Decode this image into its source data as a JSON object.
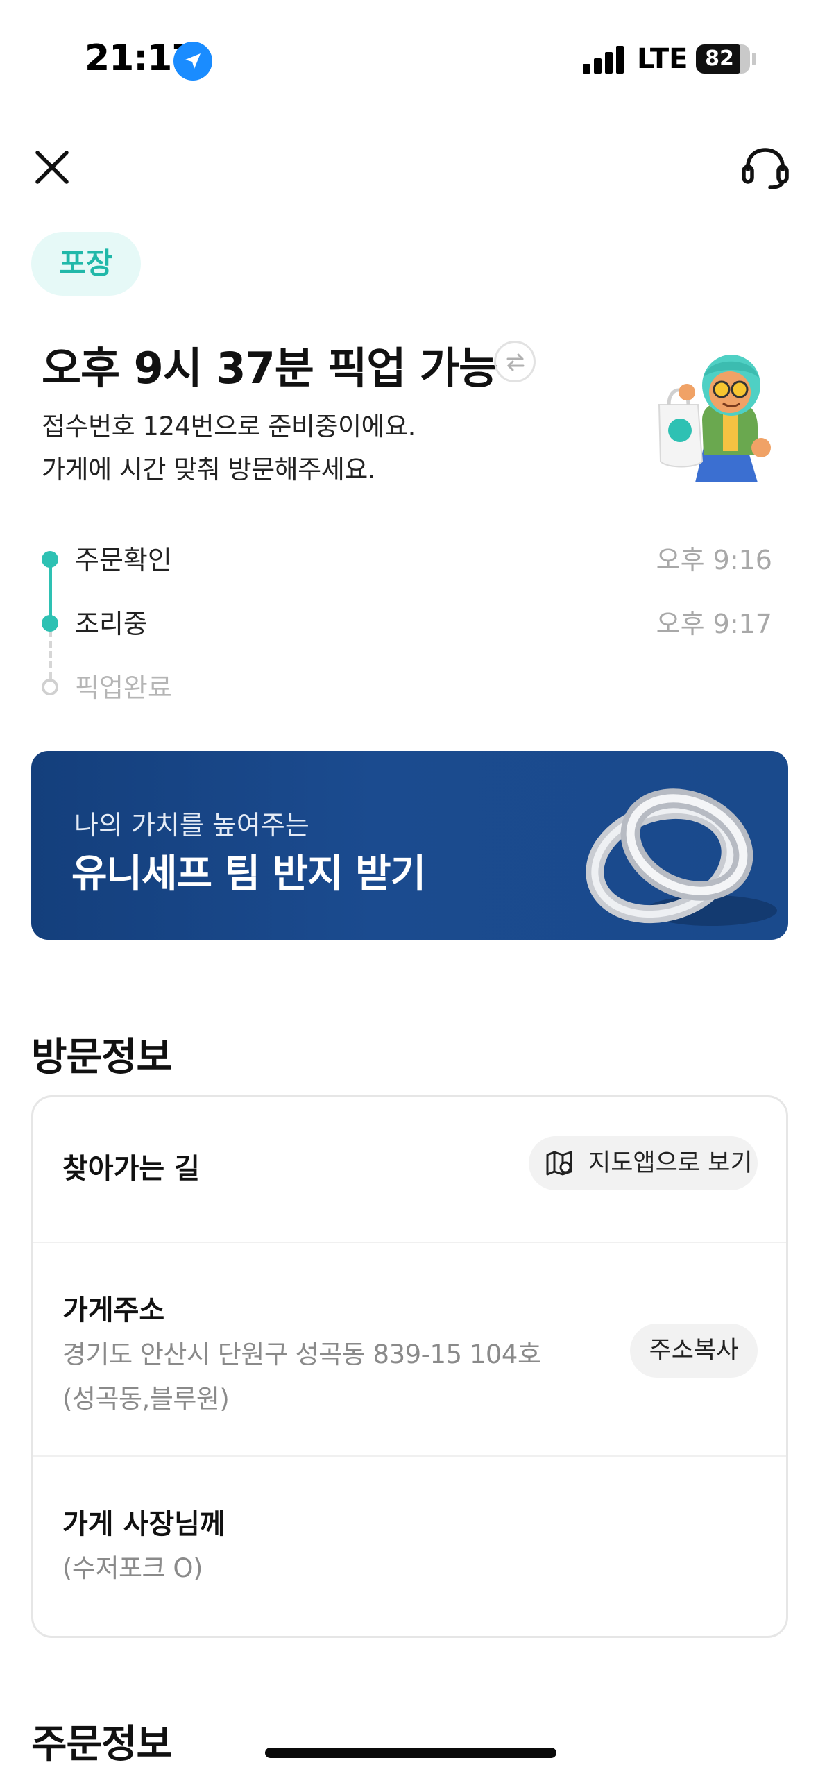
{
  "status_bar": {
    "time": "21:17",
    "network": "LTE",
    "battery": "82",
    "battery_level": 0.82
  },
  "order_type_badge": "포장",
  "headline": "오후 9시 37분 픽업 가능",
  "subtitle_line1": "접수번호 124번으로 준비중이에요.",
  "subtitle_line2": "가게에 시간 맞춰 방문해주세요.",
  "timeline": [
    {
      "label": "주문확인",
      "time": "오후 9:16",
      "done": true
    },
    {
      "label": "조리중",
      "time": "오후 9:17",
      "done": true
    },
    {
      "label": "픽업완료",
      "time": "",
      "done": false
    }
  ],
  "banner": {
    "subtitle": "나의 가치를 높여주는",
    "title": "유니세프 팀 반지 받기"
  },
  "visit_info": {
    "title": "방문정보",
    "directions_label": "찾아가는 길",
    "map_button": "지도앱으로 보기",
    "address_label": "가게주소",
    "address_line1": "경기도 안산시 단원구 성곡동 839-15 104호",
    "address_line2": "(성곡동,블루원)",
    "copy_button": "주소복사",
    "owner_label": "가게 사장님께",
    "owner_request": "(수저포크 O)"
  },
  "order_info": {
    "title": "주문정보"
  },
  "colors": {
    "accent": "#2ec1b3",
    "badge_bg": "#e6f9f7",
    "banner_bg": "#1b4b8f"
  }
}
